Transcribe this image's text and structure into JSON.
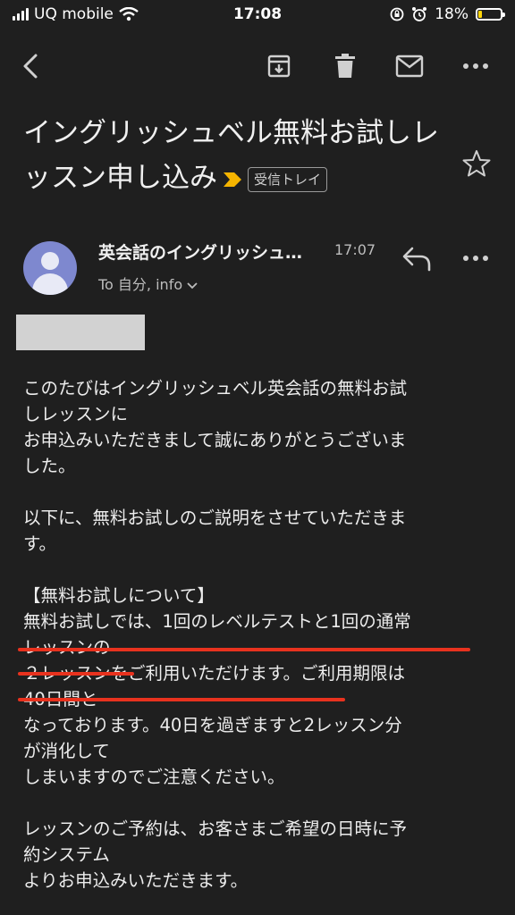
{
  "status_bar": {
    "carrier": "UQ mobile",
    "time": "17:08",
    "battery_percent": "18%",
    "battery_level": 0.18,
    "battery_color": "#ffd60a"
  },
  "toolbar": {
    "icons": [
      "back-icon",
      "archive-icon",
      "delete-icon",
      "mail-icon",
      "more-icon"
    ]
  },
  "email": {
    "subject": "イングリッシュベル無料お試しレッスン申し込み",
    "importance_color": "#f5b400",
    "label": "受信トレイ",
    "sender": "英会話のイングリッシュ…",
    "time": "17:07",
    "recipients": "To 自分, info",
    "body": [
      "このたびはイングリッシュベル英会話の無料お試",
      "しレッスンに",
      "お申込みいただきまして誠にありがとうございま",
      "した。",
      "",
      "以下に、無料お試しのご説明をさせていただきま",
      "す。",
      "",
      "【無料お試しについて】",
      "無料お試しでは、1回のレベルテストと1回の通常",
      "レッスンの",
      "２レッスンをご利用いただけます。ご利用期限は",
      "40日間と",
      "なっております。40日を過ぎますと2レッスン分",
      "が消化して",
      "しまいますのでご注意ください。",
      "",
      "レッスンのご予約は、お客さまご希望の日時に予",
      "約システム",
      "よりお申込みいただきます。"
    ]
  },
  "highlight_color": "#e8321e"
}
